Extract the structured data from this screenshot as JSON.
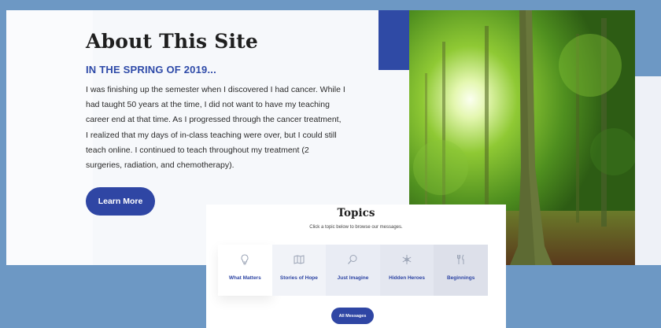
{
  "about": {
    "title": "About This Site",
    "subtitle": "IN THE SPRING OF 2019...",
    "body": "I was finishing up the semester when I discovered I had cancer. While I had taught 50 years at the time, I did not want to have my teaching career end at that time.  As I progressed through the cancer treatment, I realized that my days of in-class teaching were over, but I could still teach online.  I continued to teach throughout my treatment (2 surgeries, radiation, and chemotherapy).",
    "button_label": "Learn More"
  },
  "topics": {
    "title": "Topics",
    "subtitle": "Click a topic below to browse our messages.",
    "items": [
      {
        "label": "What Matters",
        "icon": "lightbulb-icon"
      },
      {
        "label": "Stories of Hope",
        "icon": "map-icon"
      },
      {
        "label": "Just Imagine",
        "icon": "search-icon"
      },
      {
        "label": "Hidden Heroes",
        "icon": "snowflake-icon"
      },
      {
        "label": "Beginnings",
        "icon": "utensils-icon"
      }
    ],
    "button_label": "All Messages"
  },
  "colors": {
    "accent": "#2f46a4",
    "page_background": "#6d98c4"
  }
}
